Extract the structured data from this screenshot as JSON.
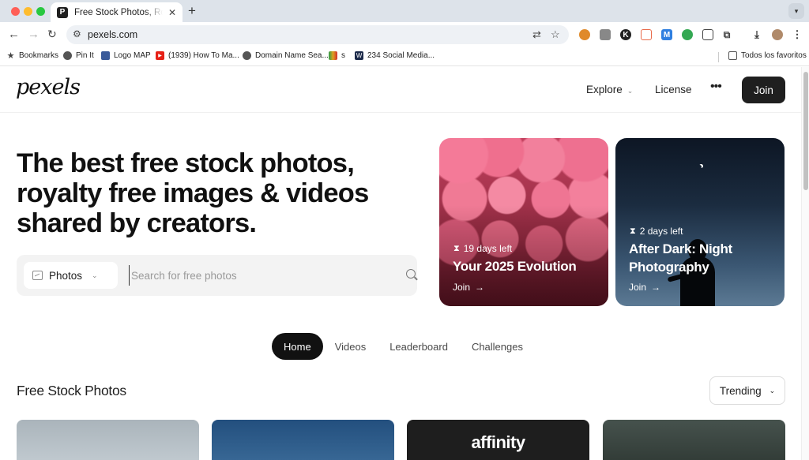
{
  "browser": {
    "tab_title": "Free Stock Photos, Royalty Free",
    "tab_favicon": "P",
    "url": "pexels.com",
    "bookmarks": [
      {
        "label": "Bookmarks",
        "icon": "star-icon"
      },
      {
        "label": "Pin It",
        "icon": "globe-icon"
      },
      {
        "label": "Logo MAP",
        "icon": "map-icon"
      },
      {
        "label": "(1939) How To Ma...",
        "icon": "youtube-icon"
      },
      {
        "label": "Domain Name Sea...",
        "icon": "globe-icon"
      },
      {
        "label": "s",
        "icon": "flag-icon"
      },
      {
        "label": "234 Social Media...",
        "icon": "w-icon"
      }
    ],
    "all_bookmarks_label": "Todos los favoritos"
  },
  "header": {
    "logo": "pexels",
    "explore_label": "Explore",
    "license_label": "License",
    "more_label": "•••",
    "join_label": "Join"
  },
  "hero": {
    "title_line1": "The best free stock photos,",
    "title_line2": "royalty free images & videos",
    "title_line3": "shared by creators."
  },
  "search": {
    "type_label": "Photos",
    "placeholder": "Search for free photos"
  },
  "challenges": [
    {
      "days_left": "19 days left",
      "title": "Your 2025 Evolution",
      "join_label": "Join"
    },
    {
      "days_left": "2 days left",
      "title": "After Dark: Night Photography",
      "join_label": "Join"
    }
  ],
  "tabs": [
    {
      "label": "Home",
      "active": true
    },
    {
      "label": "Videos",
      "active": false
    },
    {
      "label": "Leaderboard",
      "active": false
    },
    {
      "label": "Challenges",
      "active": false
    }
  ],
  "section": {
    "title": "Free Stock Photos",
    "sort_label": "Trending"
  },
  "photos": [
    {
      "overlay_text": ""
    },
    {
      "overlay_text": ""
    },
    {
      "overlay_text": "affinity"
    },
    {
      "overlay_text": ""
    }
  ],
  "colors": {
    "brand_dark": "#1f1f1f",
    "tab_active": "#111111",
    "chrome_bg": "#dde3ea"
  }
}
